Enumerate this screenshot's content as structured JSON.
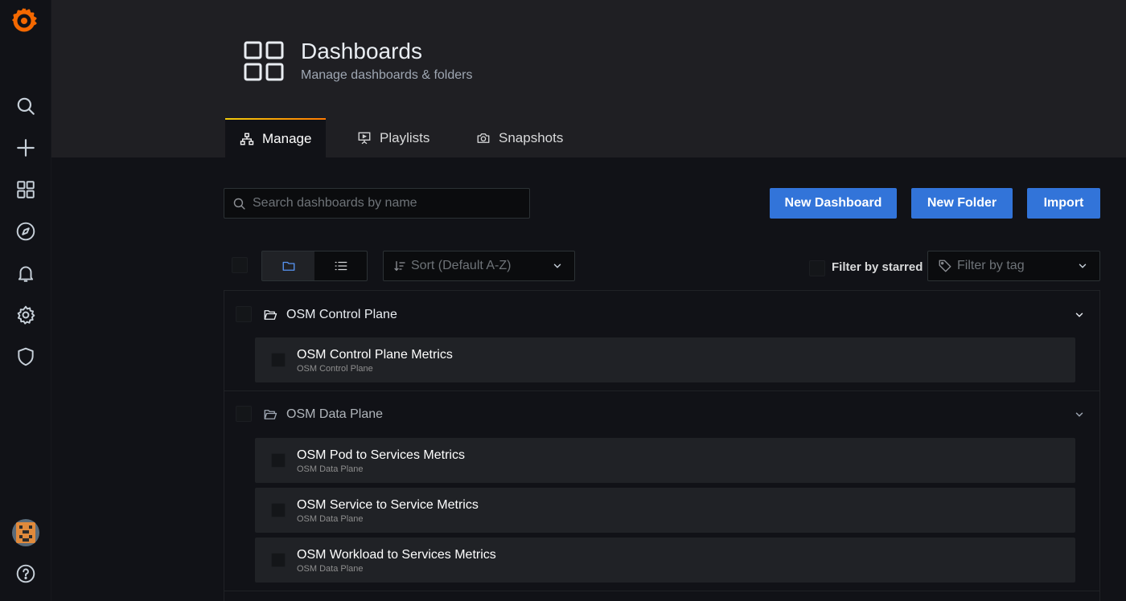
{
  "header": {
    "title": "Dashboards",
    "subtitle": "Manage dashboards & folders",
    "tabs": [
      {
        "label": "Manage",
        "icon": "sitemap-icon",
        "active": true
      },
      {
        "label": "Playlists",
        "icon": "presentation-icon",
        "active": false
      },
      {
        "label": "Snapshots",
        "icon": "camera-icon",
        "active": false
      }
    ]
  },
  "sidebar": {
    "items": [
      {
        "icon": "search-icon"
      },
      {
        "icon": "plus-icon"
      },
      {
        "icon": "dashboards-icon"
      },
      {
        "icon": "compass-icon"
      },
      {
        "icon": "bell-icon"
      },
      {
        "icon": "gear-icon"
      },
      {
        "icon": "shield-icon"
      },
      {
        "icon": "avatar"
      },
      {
        "icon": "help-icon"
      }
    ]
  },
  "toolbar": {
    "search_placeholder": "Search dashboards by name",
    "new_dashboard": "New Dashboard",
    "new_folder": "New Folder",
    "import": "Import",
    "sort_label": "Sort (Default A-Z)",
    "filter_starred": "Filter by starred",
    "filter_tag": "Filter by tag"
  },
  "folders": [
    {
      "name": "OSM Control Plane",
      "expanded": true,
      "dashboards": [
        {
          "title": "OSM Control Plane Metrics",
          "folder": "OSM Control Plane"
        }
      ]
    },
    {
      "name": "OSM Data Plane",
      "expanded": true,
      "dashboards": [
        {
          "title": "OSM Pod to Services Metrics",
          "folder": "OSM Data Plane"
        },
        {
          "title": "OSM Service to Service Metrics",
          "folder": "OSM Data Plane"
        },
        {
          "title": "OSM Workload to Services Metrics",
          "folder": "OSM Data Plane"
        }
      ]
    }
  ],
  "colors": {
    "accent": "#3274d9",
    "tab_active_border": "#eb7b18",
    "logo": "#f46800"
  }
}
